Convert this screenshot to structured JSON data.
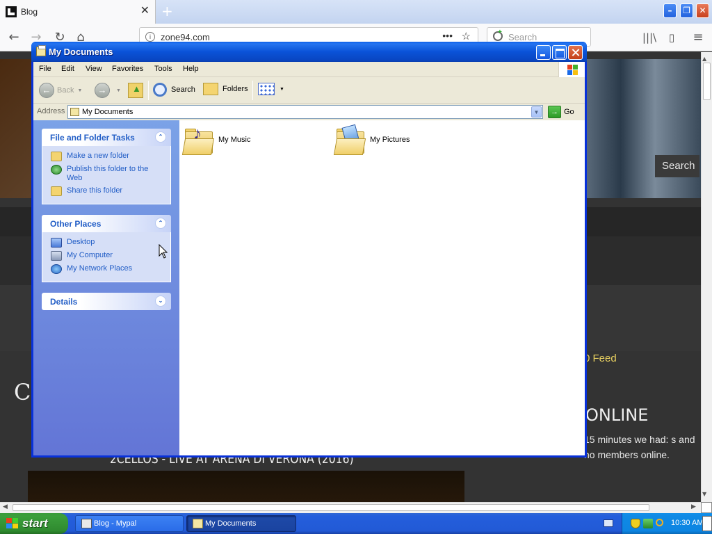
{
  "browser": {
    "tab_title": "Blog",
    "tab_close": "✕",
    "new_tab": "+",
    "url": "zone94.com",
    "search_placeholder": "Search",
    "controls": {
      "minimize": "–",
      "maximize": "❐",
      "close": "✕"
    },
    "page": {
      "nav_search": "Search",
      "feed_link": "0 Feed",
      "online_title": "ONLINE",
      "online_text": "15 minutes we had: s and no members online.",
      "article_title": "2CELLOS - LIVE AT ARENA DI VERONA (2016)",
      "partial_heading": "CE"
    }
  },
  "explorer": {
    "title": "My Documents",
    "menu": [
      "File",
      "Edit",
      "View",
      "Favorites",
      "Tools",
      "Help"
    ],
    "toolbar": {
      "back": "Back",
      "search": "Search",
      "folders": "Folders"
    },
    "address": {
      "label": "Address",
      "value": "My Documents",
      "go": "Go"
    },
    "task_pane": {
      "file_tasks": {
        "title": "File and Folder Tasks",
        "items": [
          "Make a new folder",
          "Publish this folder to the Web",
          "Share this folder"
        ]
      },
      "other_places": {
        "title": "Other Places",
        "items": [
          "Desktop",
          "My Computer",
          "My Network Places"
        ]
      },
      "details": {
        "title": "Details"
      }
    },
    "files": [
      {
        "name": "My Music",
        "icon": "music-folder-icon"
      },
      {
        "name": "My Pictures",
        "icon": "pictures-folder-icon"
      }
    ]
  },
  "taskbar": {
    "start": "start",
    "tasks": [
      "Blog - Mypal",
      "My Documents"
    ],
    "clock": "10:30 AM"
  },
  "colors": {
    "xp_blue": "#0831d9",
    "start_green": "#3c9f3c",
    "task_link": "#215dc6"
  }
}
